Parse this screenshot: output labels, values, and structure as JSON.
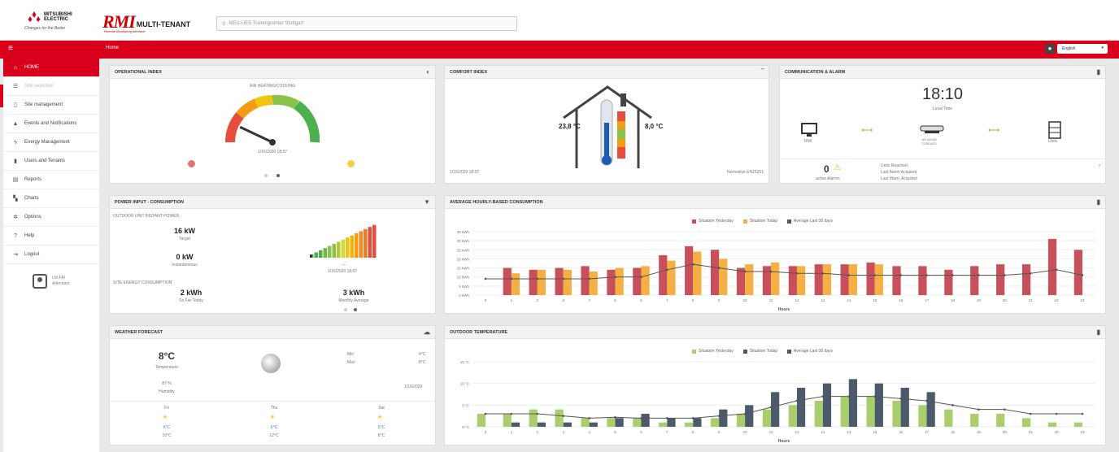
{
  "header": {
    "brand_name": "MITSUBISHI ELECTRIC",
    "brand_tagline": "Changes for the Better",
    "product_logo": "RMI",
    "product_suffix": "MULTI-TENANT",
    "product_sub": "Remote Monitoring Interface",
    "search_placeholder": "MEU-UES Trainingcenter Stuttgart"
  },
  "nav": {
    "breadcrumb": "Home",
    "language": "English"
  },
  "sidebar": {
    "items": [
      {
        "label": "HOME",
        "icon": "home-icon",
        "active": true
      },
      {
        "label": "Site selection",
        "icon": "list-icon",
        "dim": true
      },
      {
        "label": "Site management",
        "icon": "document-icon"
      },
      {
        "label": "Events and Notifications",
        "icon": "warning-icon"
      },
      {
        "label": "Energy Management",
        "icon": "bolt-icon"
      },
      {
        "label": "Users and Tenants",
        "icon": "users-icon"
      },
      {
        "label": "Reports",
        "icon": "report-icon"
      },
      {
        "label": "Charts",
        "icon": "chart-icon"
      },
      {
        "label": "Options",
        "icon": "options-icon"
      },
      {
        "label": "Help",
        "icon": "help-icon"
      },
      {
        "label": "Logout",
        "icon": "logout-icon"
      }
    ],
    "user_name": "LM-FM",
    "user_role": "Attendant"
  },
  "operational": {
    "title": "OPERATIONAL INDEX",
    "mode": "AIR HEATING/COOLING",
    "timestamp": "1/16/2020 18:07",
    "gauge_level": 0.14
  },
  "comfort": {
    "title": "COMFORT INDEX",
    "temp_in": "23,8 °C",
    "temp_out": "8,0 °C",
    "timestamp": "1/16/2020 18:07",
    "ref": "Normative EN15251"
  },
  "comm": {
    "title": "COMMUNICATION & ALARM",
    "time": "18:10",
    "time_label": "Local Time",
    "dev_pc": "RMI",
    "dev_ctrl": "AH-00106\nTCREADY",
    "dev_unit": "Units",
    "alarms": "0",
    "alarms_label": "active Alarms",
    "info1": "Units Reached",
    "info2": "Last Alarm Acquired",
    "info3": "Last Warn. Acquired"
  },
  "power": {
    "title": "POWER INPUT - CONSUMPTION",
    "section1": "OUTDOOR UNIT INSTANT POWER",
    "target_value": "16 kW",
    "target_label": "Target",
    "inst_value": "0 kW",
    "inst_label": "Instantaneous",
    "dash": "---",
    "timestamp": "1/16/2020 18:07",
    "section2": "SITE ENERGY CONSUMPTION",
    "today_value": "2 kWh",
    "today_label": "So Far Today",
    "month_value": "3 kWh",
    "month_label": "Monthly Average"
  },
  "weather": {
    "title": "WEATHER FORECAST",
    "temp": "8°C",
    "temp_label": "Temperature",
    "humidity": "87 %",
    "humidity_label": "Humidity",
    "min_label": "Min",
    "min_value": "4°C",
    "max_label": "Max",
    "max_value": "8°C",
    "date": "1/16/2020",
    "days": [
      {
        "day": "Fri",
        "lo": "6°C",
        "hi": "10°C"
      },
      {
        "day": "Thu",
        "lo": "6°C",
        "hi": "12°C"
      },
      {
        "day": "Sat",
        "lo": "5°C",
        "hi": "8°C"
      }
    ]
  },
  "colors": {
    "red": "#d9001b",
    "bar_yesterday": "#c8505a",
    "bar_today": "#f4b042",
    "line_avg": "#555555",
    "temp_yesterday": "#a9cf6c",
    "temp_today": "#4d5a6b"
  },
  "chart_data": [
    {
      "type": "bar",
      "title": "AVERAGE HOURLY-BASED CONSUMPTION",
      "xlabel": "Hours",
      "ylabel": "",
      "categories": [
        "0",
        "1",
        "2",
        "3",
        "4",
        "5",
        "6",
        "7",
        "8",
        "9",
        "10",
        "11",
        "12",
        "13",
        "14",
        "15",
        "16",
        "17",
        "18",
        "19",
        "20",
        "21",
        "22",
        "23"
      ],
      "series": [
        {
          "name": "Situation Yesterday",
          "values": [
            0,
            15,
            14,
            15,
            16,
            14,
            15,
            22,
            27,
            25,
            15,
            16,
            16,
            17,
            17,
            18,
            16,
            16,
            14,
            16,
            17,
            17,
            31,
            25
          ]
        },
        {
          "name": "Situation Today",
          "values": [
            0,
            12,
            14,
            14,
            13,
            15,
            16,
            19,
            24,
            20,
            17,
            18,
            16,
            17,
            17,
            17,
            0,
            0,
            0,
            0,
            0,
            0,
            0,
            0
          ]
        },
        {
          "name": "Average Last 30 days",
          "values": [
            9,
            9,
            9,
            9,
            9,
            10,
            10,
            14,
            17,
            15,
            13,
            13,
            12,
            12,
            11,
            11,
            11,
            11,
            11,
            11,
            11,
            12,
            14,
            11
          ]
        }
      ],
      "yticks": [
        "0 kWh",
        "5 kWh",
        "10 kWh",
        "15 kWh",
        "20 kWh",
        "25 kWh",
        "30 kWh",
        "35 kWh"
      ],
      "ylim": [
        0,
        35
      ]
    },
    {
      "type": "bar",
      "title": "OUTDOOR TEMPERATURE",
      "xlabel": "Hours",
      "ylabel": "",
      "categories": [
        "0",
        "1",
        "2",
        "3",
        "4",
        "5",
        "6",
        "7",
        "8",
        "9",
        "10",
        "11",
        "12",
        "13",
        "14",
        "15",
        "16",
        "17",
        "18",
        "19",
        "20",
        "21",
        "22",
        "23"
      ],
      "series": [
        {
          "name": "Situation Yesterday",
          "values": [
            3,
            3,
            4,
            4,
            2,
            2,
            2,
            1,
            1,
            2,
            3,
            4,
            5,
            6,
            7,
            7,
            6,
            5,
            4,
            3,
            3,
            2,
            1,
            1
          ]
        },
        {
          "name": "Situation Today",
          "values": [
            0,
            1,
            1,
            1,
            1,
            2,
            3,
            2,
            2,
            4,
            5,
            8,
            9,
            10,
            11,
            10,
            9,
            8,
            0,
            0,
            0,
            0,
            0,
            0
          ]
        },
        {
          "name": "Average Last 30 days",
          "values": [
            3,
            3,
            3,
            2.5,
            2,
            2.2,
            2,
            2,
            2,
            2.5,
            3,
            4.5,
            6,
            7,
            7,
            7,
            6.5,
            6,
            5,
            4,
            4,
            3,
            3,
            3
          ]
        }
      ],
      "yticks": [
        "0 °C",
        "5 °C",
        "10 °C",
        "15 °C"
      ],
      "ylim": [
        0,
        15
      ]
    }
  ]
}
